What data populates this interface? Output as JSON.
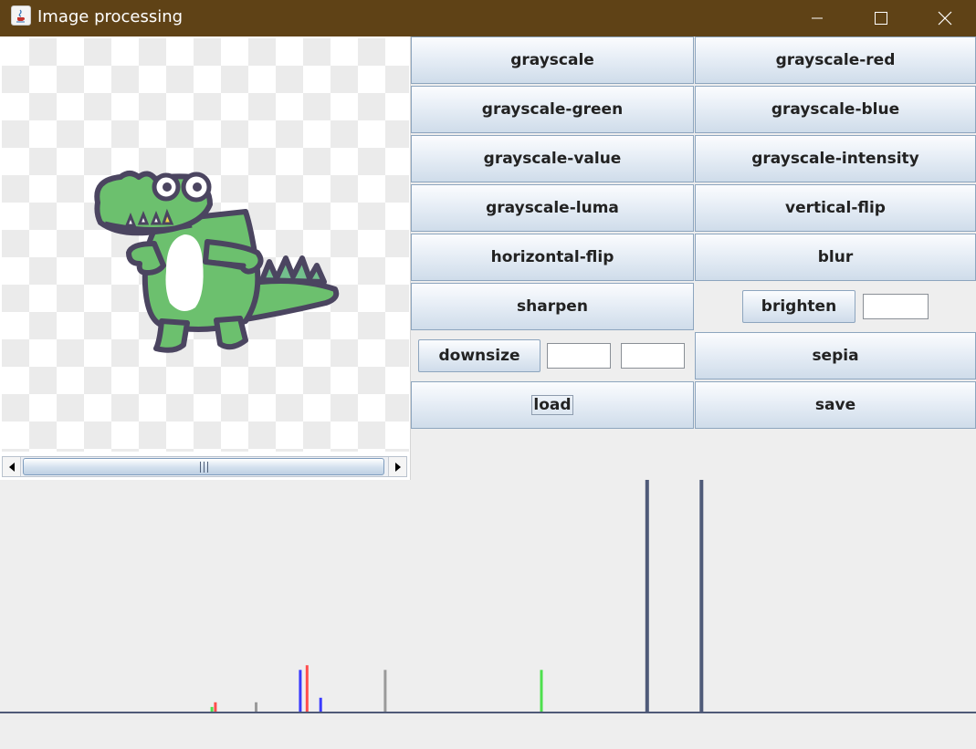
{
  "window": {
    "title": "Image processing",
    "app_icon": "java-icon",
    "controls": [
      "minimize-icon",
      "maximize-icon",
      "close-icon"
    ],
    "titlebar_color": "#5f4216"
  },
  "image_panel": {
    "image": "green-crocodile-cartoon",
    "scroll": "horizontal-scrollbar"
  },
  "buttons": {
    "grayscale": "grayscale",
    "grayscale_red": "grayscale-red",
    "grayscale_green": "grayscale-green",
    "grayscale_blue": "grayscale-blue",
    "grayscale_value": "grayscale-value",
    "grayscale_intensity": "grayscale-intensity",
    "grayscale_luma": "grayscale-luma",
    "vertical_flip": "vertical-flip",
    "horizontal_flip": "horizontal-flip",
    "blur": "blur",
    "sharpen": "sharpen",
    "brighten": "brighten",
    "downsize": "downsize",
    "sepia": "sepia",
    "load": "load",
    "save": "save"
  },
  "inputs": {
    "brighten_value": "",
    "downsize_width": "",
    "downsize_height": ""
  },
  "histogram": {
    "colors": {
      "red": "#ff4d4d",
      "green": "#4ee04e",
      "blue": "#3a3aff",
      "intensity": "#9a9a9a",
      "dominant": "#4f5a78",
      "axis": "#4f5a78"
    },
    "peaks": [
      {
        "channel": "green",
        "bin": 62,
        "value": 0.02
      },
      {
        "channel": "red",
        "bin": 63,
        "value": 0.04
      },
      {
        "channel": "intensity",
        "bin": 75,
        "value": 0.04
      },
      {
        "channel": "blue",
        "bin": 88,
        "value": 0.18
      },
      {
        "channel": "red",
        "bin": 90,
        "value": 0.2
      },
      {
        "channel": "blue",
        "bin": 94,
        "value": 0.06
      },
      {
        "channel": "intensity",
        "bin": 113,
        "value": 0.18
      },
      {
        "channel": "green",
        "bin": 159,
        "value": 0.18
      },
      {
        "channel": "dominant",
        "bin": 190,
        "value": 1.0
      },
      {
        "channel": "dominant",
        "bin": 206,
        "value": 1.0
      }
    ]
  }
}
